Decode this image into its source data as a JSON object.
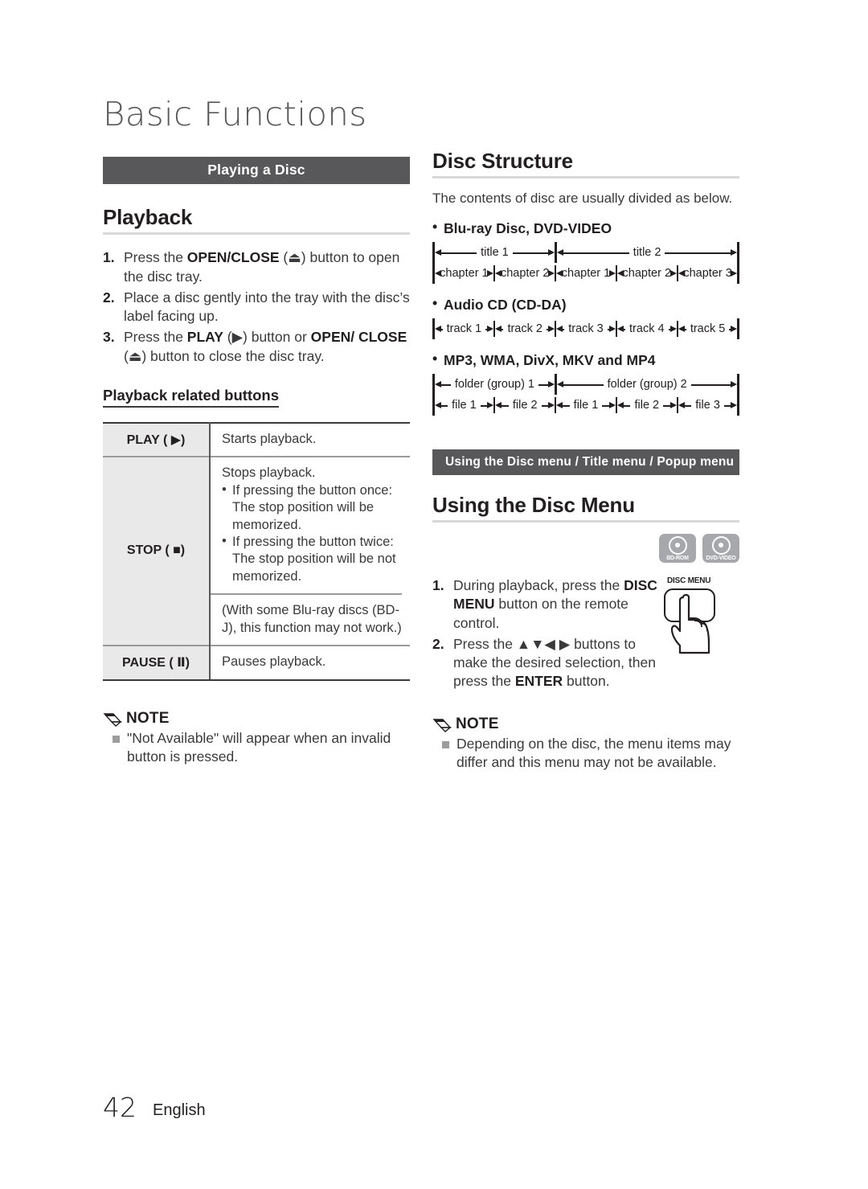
{
  "page": {
    "chapter_title": "Basic Functions",
    "page_number": "42",
    "language": "English"
  },
  "left": {
    "banner": "Playing a Disc",
    "playback_heading": "Playback",
    "steps": [
      {
        "num": "1.",
        "parts": [
          {
            "t": "Press the ",
            "b": false
          },
          {
            "t": "OPEN/CLOSE",
            "b": true
          },
          {
            "t": " (⏏) button to open the disc tray.",
            "b": false
          }
        ]
      },
      {
        "num": "2.",
        "parts": [
          {
            "t": "Place a disc gently into the tray with the disc’s label facing up.",
            "b": false
          }
        ]
      },
      {
        "num": "3.",
        "parts": [
          {
            "t": "Press the ",
            "b": false
          },
          {
            "t": "PLAY",
            "b": true
          },
          {
            "t": " (▶) button or ",
            "b": false
          },
          {
            "t": "OPEN/ CLOSE",
            "b": true
          },
          {
            "t": " (⏏) button to close the disc tray.",
            "b": false
          }
        ]
      }
    ],
    "table_heading": "Playback related buttons",
    "table": {
      "rows": [
        {
          "key": "PLAY ( ▶)",
          "lines": [
            "Starts playback."
          ],
          "bullets": [],
          "paren": ""
        },
        {
          "key": "STOP ( ■)",
          "lines": [
            "Stops playback."
          ],
          "bullets": [
            "If pressing the button once: The stop position will be memorized.",
            "If pressing the button twice: The stop position will be not memorized."
          ],
          "paren": "(With some Blu-ray discs (BD-J), this function may not work.)"
        },
        {
          "key": "PAUSE ( Ⅱ)",
          "lines": [
            "Pauses playback."
          ],
          "bullets": [],
          "paren": ""
        }
      ]
    },
    "note": {
      "label": "NOTE",
      "items": [
        "\"Not Available\" will appear when an invalid button is pressed."
      ]
    }
  },
  "right": {
    "disc_structure_heading": "Disc Structure",
    "disc_structure_lead": "The contents of disc are usually divided as below.",
    "formats": [
      {
        "label": "Blu-ray Disc, DVD-VIDEO",
        "top_row": [
          "title 1",
          "title 2"
        ],
        "bottom_row": [
          "chapter 1",
          "chapter 2",
          "chapter 1",
          "chapter 2",
          "chapter 3"
        ],
        "top_groups": [
          2,
          3
        ]
      },
      {
        "label": "Audio CD (CD-DA)",
        "top_row": [],
        "bottom_row": [
          "track 1",
          "track 2",
          "track 3",
          "track 4",
          "track 5"
        ],
        "top_groups": []
      },
      {
        "label": "MP3, WMA, DivX, MKV and MP4",
        "top_row": [
          "folder (group) 1",
          "folder (group) 2"
        ],
        "bottom_row": [
          "file 1",
          "file 2",
          "file 1",
          "file 2",
          "file 3"
        ],
        "top_groups": [
          2,
          3
        ]
      }
    ],
    "banner": "Using the Disc menu / Title menu / Popup menu",
    "disc_menu_heading": "Using the Disc Menu",
    "badges": [
      {
        "name": "BD-ROM",
        "icon": "disc-icon"
      },
      {
        "name": "DVD-VIDEO",
        "icon": "disc-icon"
      }
    ],
    "remote": {
      "caption": "DISC MENU"
    },
    "steps": [
      {
        "num": "1.",
        "parts": [
          {
            "t": "During playback, press the ",
            "b": false
          },
          {
            "t": "DISC MENU",
            "b": true
          },
          {
            "t": "  button on the remote control.",
            "b": false
          }
        ]
      },
      {
        "num": "2.",
        "parts": [
          {
            "t": "Press the ▲▼◀ ▶ buttons to make the desired selection, then press the ",
            "b": false
          },
          {
            "t": "ENTER",
            "b": true
          },
          {
            "t": " button.",
            "b": false
          }
        ]
      }
    ],
    "note": {
      "label": "NOTE",
      "items": [
        "Depending on the disc, the menu items may differ and this menu may not be available."
      ]
    }
  },
  "colors": {
    "banner_bg": "#58585a",
    "table_key_bg": "#e9e9e9",
    "badge_bg": "#a6a8ab",
    "rule": "#d8d8d8",
    "text": "#231f20"
  }
}
